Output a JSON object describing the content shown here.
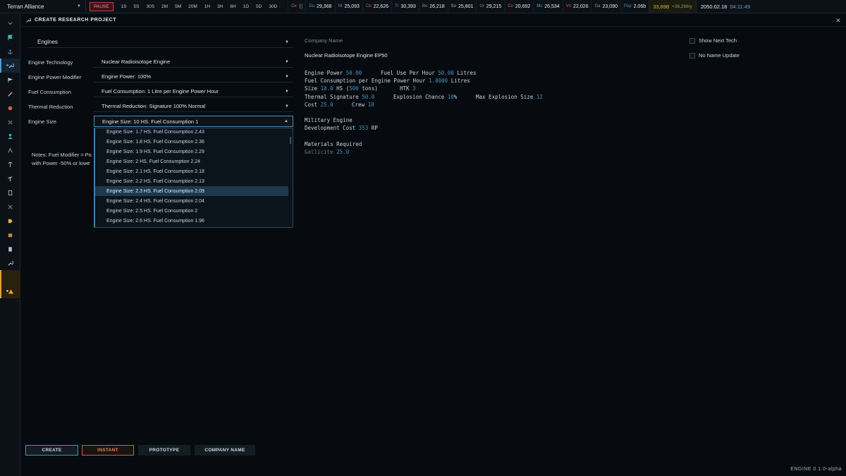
{
  "topbar": {
    "faction": "Terran Alliance",
    "speeds": [
      "PAUSE",
      "1S",
      "5S",
      "30S",
      "2M",
      "5M",
      "20M",
      "1H",
      "3H",
      "8H",
      "1D",
      "5D",
      "30D"
    ],
    "resources": [
      {
        "abbr": "Ox",
        "value": "",
        "color": "#e0584e"
      },
      {
        "abbr": "Du",
        "value": "29,368",
        "color": "#4a90bf"
      },
      {
        "abbr": "Nt",
        "value": "25,093",
        "color": "#4a90bf"
      },
      {
        "abbr": "Cb",
        "value": "22,626",
        "color": "#e0584e"
      },
      {
        "abbr": "Tr",
        "value": "30,393",
        "color": "#4a90bf"
      },
      {
        "abbr": "Bo",
        "value": "26,218",
        "color": "#6aa972"
      },
      {
        "abbr": "Sо",
        "value": "25,801",
        "color": "#e0b24a"
      },
      {
        "abbr": "Ur",
        "value": "29,215",
        "color": "#6aa972"
      },
      {
        "abbr": "Co",
        "value": "20,692",
        "color": "#e0584e"
      },
      {
        "abbr": "Mc",
        "value": "26,534",
        "color": "#4ab0b8"
      },
      {
        "abbr": "Vn",
        "value": "22,026",
        "color": "#e0584e"
      },
      {
        "abbr": "Ga",
        "value": "23,090",
        "color": "#8a96a0"
      },
      {
        "abbr": "Pop",
        "value": "2.06b",
        "color": "#4a90bf"
      }
    ],
    "stock_value": "33,698",
    "stock_rate": "+36,268/y",
    "date": "2050.02.18",
    "time": "04:11:49"
  },
  "window": {
    "title": "CREATE RESEARCH PROJECT",
    "close_icon": "close-icon"
  },
  "form": {
    "engine_type": "Engines",
    "rows": [
      {
        "label": "Engine Technology",
        "value": "Nuclear Radioisotope Engine"
      },
      {
        "label": "Engine Power Modifier",
        "value": "Engine Power: 100%"
      },
      {
        "label": "Fuel Consumption",
        "value": "Fuel Consumption: 1 Litre per Engine Power Hour"
      },
      {
        "label": "Thermal Reduction",
        "value": "Thermal Reduction: Signature 100% Normal"
      },
      {
        "label": "Engine Size",
        "value": "Engine Size: 10 HS. Fuel Consumption 1"
      }
    ],
    "notes_line1": "Notes: Fuel Modifier = Po",
    "notes_line2": "with Power -50% or lowe"
  },
  "dropdown": {
    "items": [
      "Engine Size: 1.7 HS. Fuel Consumption 2.43",
      "Engine Size: 1.8 HS. Fuel Consumption 2.36",
      "Engine Size: 1.9 HS. Fuel Consumption 2.29",
      "Engine Size: 2 HS. Fuel Consumption 2.24",
      "Engine Size: 2.1 HS. Fuel Consumption 2.18",
      "Engine Size: 2.2 HS. Fuel Consumption 2.13",
      "Engine Size: 2.3 HS. Fuel Consumption 2.09",
      "Engine Size: 2.4 HS. Fuel Consumption 2.04",
      "Engine Size: 2.5 HS. Fuel Consumption 2",
      "Engine Size: 2.6 HS. Fuel Consumption 1.96"
    ],
    "selected_index": 6
  },
  "info": {
    "company_label": "Company Name",
    "company_value": "Nuclear Radioisotope Engine  EP50",
    "engine_power_label": "Engine Power",
    "engine_power": "50.00",
    "fuel_use_label": "Fuel Use Per Hour",
    "fuel_use": "50.00",
    "fuel_use_unit": "Litres",
    "fuel_per_power_label": "Fuel Consumption per Engine Power Hour",
    "fuel_per_power": "1.0000",
    "fuel_per_power_unit": "Litres",
    "size_label": "Size",
    "size": "10.0",
    "size_unit": "HS",
    "tons": "500",
    "tons_unit": "tons",
    "htk_label": "HTK",
    "htk": "3",
    "thermal_label": "Thermal Signature",
    "thermal": "50.0",
    "explosion_chance_label": "Explosion Chance",
    "explosion_chance": "10",
    "max_explosion_label": "Max Explosion Size",
    "max_explosion": "12",
    "cost_label": "Cost",
    "cost": "25.0",
    "crew_label": "Crew",
    "crew": "10",
    "military": "Military Engine",
    "dev_cost_label": "Development Cost",
    "dev_cost": "353",
    "dev_cost_unit": "RP",
    "materials_label": "Materials Required",
    "material_name": "Gallicite",
    "material_amount": "25.0"
  },
  "options": {
    "show_next_tech": "Show Next Tech",
    "no_name_update": "No Name Update"
  },
  "buttons": {
    "create": "CREATE",
    "instant": "INSTANT",
    "prototype": "PROTOTYPE",
    "company_name": "COMPANY NAME"
  },
  "version": "ENGINE  0.1.0-alpha"
}
